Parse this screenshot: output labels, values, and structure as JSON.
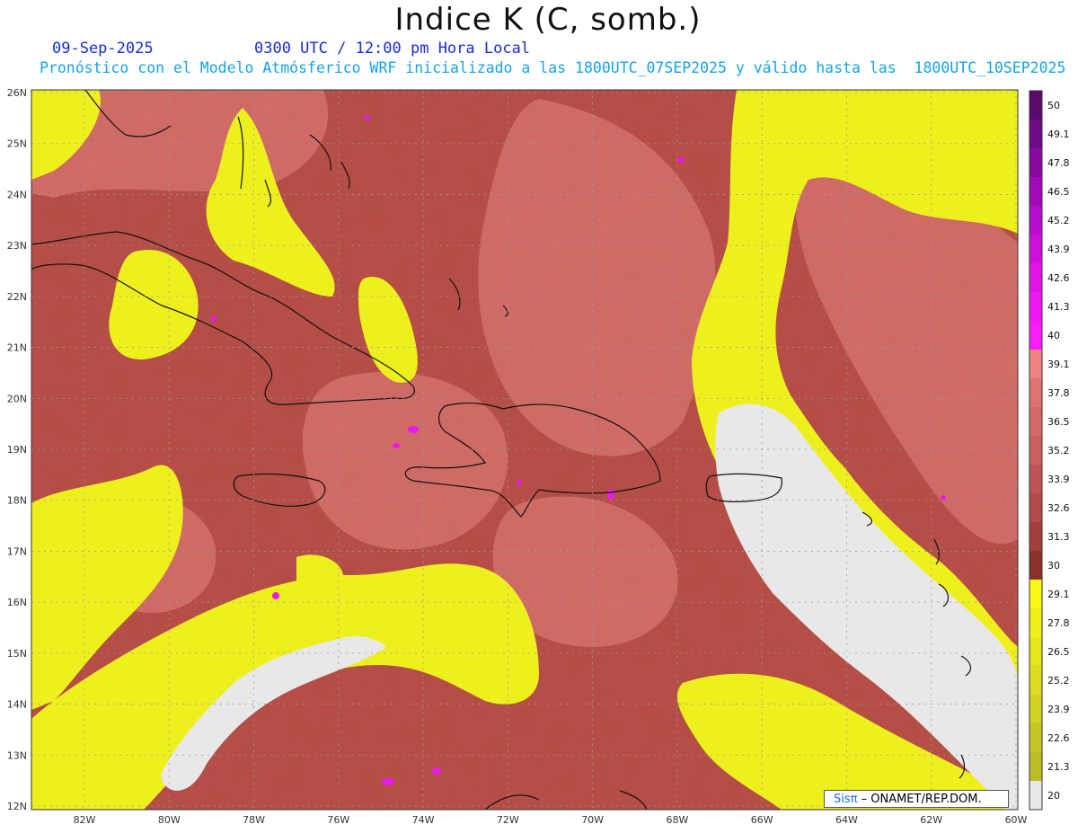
{
  "header": {
    "title": "Indice K (C, somb.)",
    "date": "09-Sep-2025",
    "time": "0300 UTC / 12:00 pm Hora Local",
    "description": "Pronóstico con el Modelo Atmósferico WRF inicializado a las 1800UTC_07SEP2025 y válido hasta las  1800UTC_10SEP2025"
  },
  "credit": {
    "brand": "Sisπ",
    "text": "– ONAMET/REP.DOM."
  },
  "axes": {
    "lat_labels": [
      "26N",
      "25N",
      "24N",
      "23N",
      "22N",
      "21N",
      "20N",
      "19N",
      "18N",
      "17N",
      "16N",
      "15N",
      "14N",
      "13N",
      "12N"
    ],
    "lon_labels": [
      "82W",
      "80W",
      "78W",
      "76W",
      "74W",
      "72W",
      "70W",
      "68W",
      "66W",
      "64W",
      "62W",
      "60W"
    ]
  },
  "colorbar": {
    "labels": [
      "50",
      "49.1",
      "47.8",
      "46.5",
      "45.2",
      "43.9",
      "42.6",
      "41.3",
      "40",
      "39.1",
      "37.8",
      "36.5",
      "35.2",
      "33.9",
      "32.6",
      "31.3",
      "30",
      "29.1",
      "27.8",
      "26.5",
      "25.2",
      "23.9",
      "22.6",
      "21.3",
      "20"
    ],
    "colors": [
      "#5a0a6e",
      "#6e0a86",
      "#8a0aa0",
      "#a00ab8",
      "#b80ccc",
      "#cf10dc",
      "#e012e8",
      "#ee18f2",
      "#fa1cf8",
      "#f08282",
      "#e27272",
      "#d66868",
      "#cc5e5e",
      "#c05454",
      "#b24a4a",
      "#a23e3c",
      "#8a3226",
      "#f8f812",
      "#f0f018",
      "#e6e61c",
      "#dcdc20",
      "#d2d222",
      "#c6c624",
      "#bcbc24",
      "#e8e8e8"
    ]
  },
  "colors": {
    "high_k_background": "#b54d45",
    "mid_k": "#d8736a",
    "low_k_yellow": "#eef01e",
    "very_low_k": "#e8e8e8",
    "coastline": "#111111"
  }
}
